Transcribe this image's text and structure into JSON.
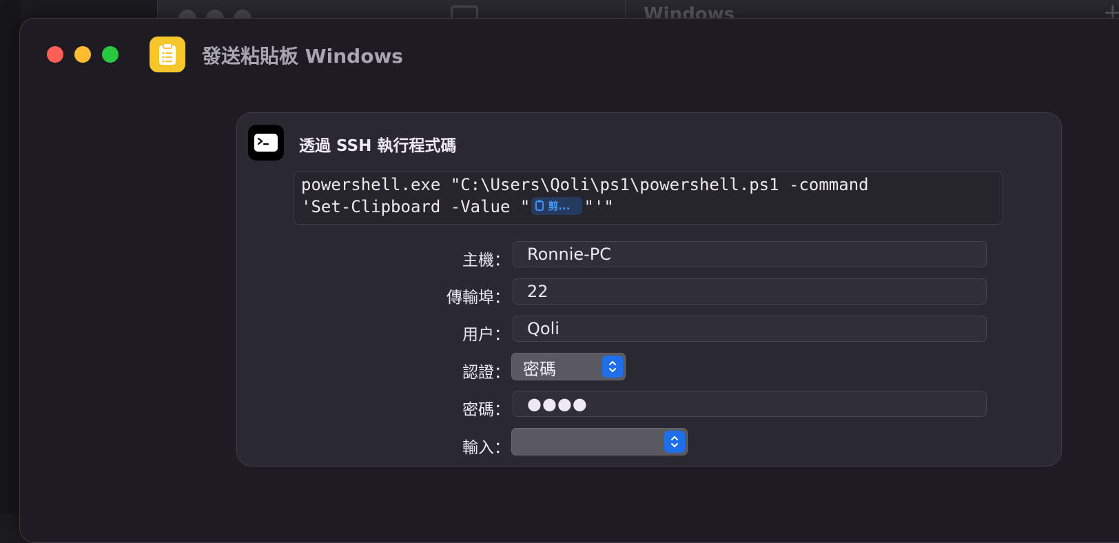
{
  "background_window": {
    "title": "Windows",
    "add_glyph": "+"
  },
  "window": {
    "title": "發送粘貼板 Windows",
    "app_icon": "clipboard-icon",
    "app_icon_color": "#f5c72a"
  },
  "action": {
    "title": "透過 SSH 執行程式碼",
    "icon": "terminal-icon",
    "script": {
      "line1": "powershell.exe \"C:\\Users\\Qoli\\ps1\\powershell.ps1 -command",
      "line2_prefix": "'Set-Clipboard -Value \"",
      "variable_label": "剪...",
      "variable_icon": "clipboard-small-icon",
      "line2_suffix": "\"'\""
    },
    "fields": {
      "host": {
        "label": "主機：",
        "value": "Ronnie-PC"
      },
      "port": {
        "label": "傳輸埠：",
        "value": "22"
      },
      "user": {
        "label": "用户：",
        "value": "Qoli"
      },
      "auth": {
        "label": "認證：",
        "value": "密碼"
      },
      "password": {
        "label": "密碼：",
        "value": "●●●●"
      },
      "input": {
        "label": "輸入：",
        "value": ""
      }
    }
  },
  "colors": {
    "accent": "#1f6feb",
    "variable_text": "#4a9bff",
    "close": "#fe5f57",
    "minimize": "#febc2e",
    "maximize": "#28c840"
  }
}
